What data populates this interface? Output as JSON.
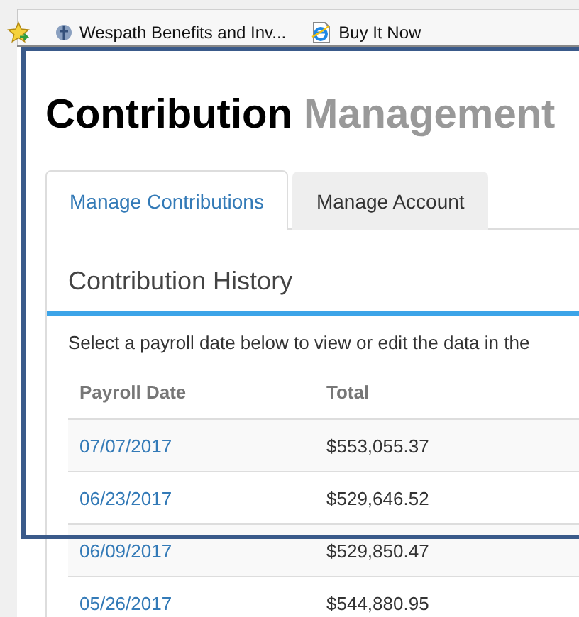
{
  "bookmarks": [
    {
      "label": "Wespath Benefits and Inv...",
      "kind": "site"
    },
    {
      "label": "Buy It Now",
      "kind": "page"
    }
  ],
  "title": {
    "main": "Contribution",
    "accent": "Management"
  },
  "tabs": [
    {
      "label": "Manage Contributions",
      "selected": true
    },
    {
      "label": "Manage Account",
      "selected": false
    }
  ],
  "section": {
    "heading": "Contribution History",
    "description": "Select a payroll date below to view or edit the data in the"
  },
  "table": {
    "columns": [
      "Payroll Date",
      "Total"
    ],
    "rows": [
      {
        "date": "07/07/2017",
        "total": "$553,055.37"
      },
      {
        "date": "06/23/2017",
        "total": "$529,646.52"
      },
      {
        "date": "06/09/2017",
        "total": "$529,850.47"
      },
      {
        "date": "05/26/2017",
        "total": "$544,880.95"
      }
    ]
  }
}
